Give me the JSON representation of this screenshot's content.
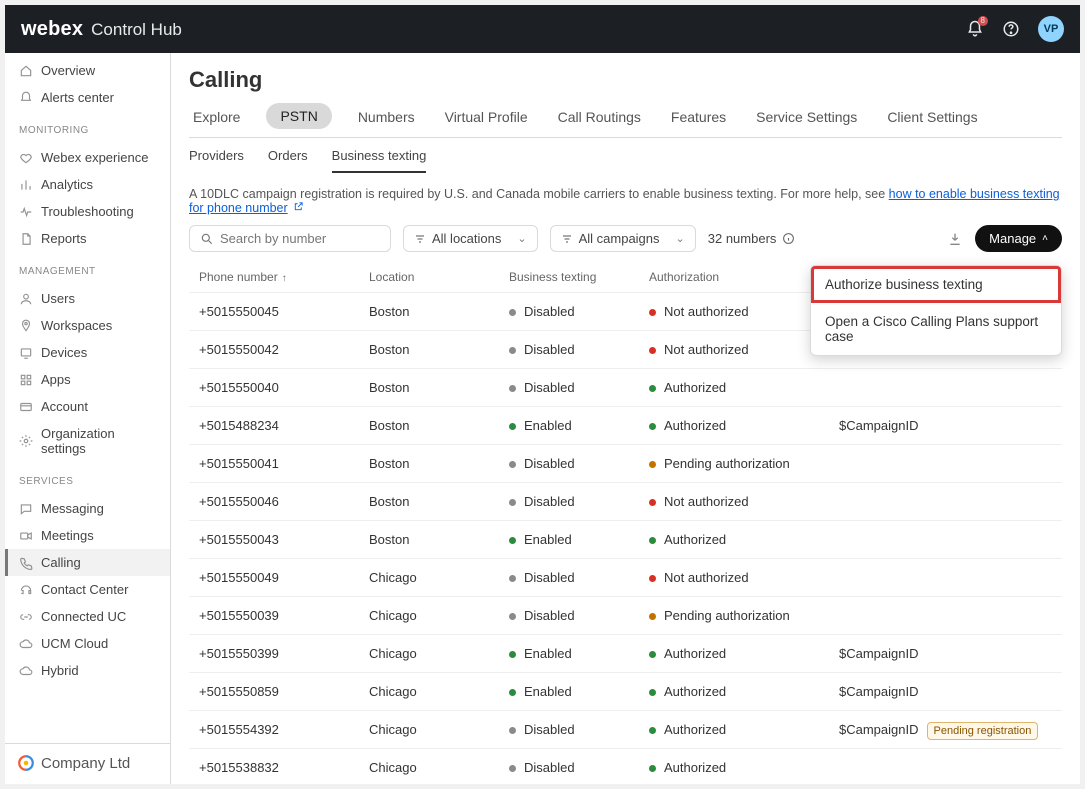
{
  "header": {
    "brand_bold": "webex",
    "brand_light": "Control Hub",
    "notif_count": "8",
    "avatar_initials": "VP"
  },
  "sidebar": {
    "top": [
      {
        "icon": "home",
        "label": "Overview"
      },
      {
        "icon": "bell",
        "label": "Alerts center"
      }
    ],
    "monitoring_label": "MONITORING",
    "monitoring": [
      {
        "icon": "heart",
        "label": "Webex experience"
      },
      {
        "icon": "bars",
        "label": "Analytics"
      },
      {
        "icon": "pulse",
        "label": "Troubleshooting"
      },
      {
        "icon": "doc",
        "label": "Reports"
      }
    ],
    "management_label": "MANAGEMENT",
    "management": [
      {
        "icon": "user",
        "label": "Users"
      },
      {
        "icon": "pin",
        "label": "Workspaces"
      },
      {
        "icon": "device",
        "label": "Devices"
      },
      {
        "icon": "grid",
        "label": "Apps"
      },
      {
        "icon": "card",
        "label": "Account"
      },
      {
        "icon": "gear",
        "label": "Organization settings"
      }
    ],
    "services_label": "SERVICES",
    "services": [
      {
        "icon": "chat",
        "label": "Messaging"
      },
      {
        "icon": "video",
        "label": "Meetings"
      },
      {
        "icon": "phone",
        "label": "Calling",
        "active": true
      },
      {
        "icon": "headset",
        "label": "Contact Center"
      },
      {
        "icon": "link",
        "label": "Connected UC"
      },
      {
        "icon": "cloud",
        "label": "UCM Cloud"
      },
      {
        "icon": "cloud2",
        "label": "Hybrid"
      }
    ],
    "footer_company": "Company Ltd"
  },
  "page": {
    "title": "Calling",
    "tabs": [
      "Explore",
      "PSTN",
      "Numbers",
      "Virtual Profile",
      "Call Routings",
      "Features",
      "Service Settings",
      "Client Settings"
    ],
    "active_tab": 1,
    "subtabs": [
      "Providers",
      "Orders",
      "Business texting"
    ],
    "active_subtab": 2,
    "info_text": "A 10DLC campaign registration is required by U.S. and Canada mobile carriers to enable business texting. For more help, see ",
    "info_link": "how to enable business texting for phone number",
    "search_placeholder": "Search by number",
    "filter_locations": "All locations",
    "filter_campaigns": "All campaigns",
    "count_label": "32 numbers",
    "manage_label": "Manage",
    "dropdown": [
      "Authorize business texting",
      "Open a Cisco Calling Plans support case"
    ],
    "columns": [
      "Phone number",
      "Location",
      "Business texting",
      "Authorization",
      ""
    ],
    "rows": [
      {
        "num": "+5015550045",
        "loc": "Boston",
        "bt": "Disabled",
        "btc": "gray",
        "auth": "Not authorized",
        "authc": "red",
        "camp": ""
      },
      {
        "num": "+5015550042",
        "loc": "Boston",
        "bt": "Disabled",
        "btc": "gray",
        "auth": "Not authorized",
        "authc": "red",
        "camp": ""
      },
      {
        "num": "+5015550040",
        "loc": "Boston",
        "bt": "Disabled",
        "btc": "gray",
        "auth": "Authorized",
        "authc": "green",
        "camp": ""
      },
      {
        "num": "+5015488234",
        "loc": "Boston",
        "bt": "Enabled",
        "btc": "green",
        "auth": "Authorized",
        "authc": "green",
        "camp": "$CampaignID"
      },
      {
        "num": "+5015550041",
        "loc": "Boston",
        "bt": "Disabled",
        "btc": "gray",
        "auth": "Pending authorization",
        "authc": "amber",
        "camp": ""
      },
      {
        "num": "+5015550046",
        "loc": "Boston",
        "bt": "Disabled",
        "btc": "gray",
        "auth": "Not authorized",
        "authc": "red",
        "camp": ""
      },
      {
        "num": "+5015550043",
        "loc": "Boston",
        "bt": "Enabled",
        "btc": "green",
        "auth": "Authorized",
        "authc": "green",
        "camp": ""
      },
      {
        "num": "+5015550049",
        "loc": "Chicago",
        "bt": "Disabled",
        "btc": "gray",
        "auth": "Not authorized",
        "authc": "red",
        "camp": ""
      },
      {
        "num": "+5015550039",
        "loc": "Chicago",
        "bt": "Disabled",
        "btc": "gray",
        "auth": "Pending authorization",
        "authc": "amber",
        "camp": ""
      },
      {
        "num": "+5015550399",
        "loc": "Chicago",
        "bt": "Enabled",
        "btc": "green",
        "auth": "Authorized",
        "authc": "green",
        "camp": "$CampaignID"
      },
      {
        "num": "+5015550859",
        "loc": "Chicago",
        "bt": "Enabled",
        "btc": "green",
        "auth": "Authorized",
        "authc": "green",
        "camp": "$CampaignID"
      },
      {
        "num": "+5015554392",
        "loc": "Chicago",
        "bt": "Disabled",
        "btc": "gray",
        "auth": "Authorized",
        "authc": "green",
        "camp": "$CampaignID",
        "badge": "Pending registration"
      },
      {
        "num": "+5015538832",
        "loc": "Chicago",
        "bt": "Disabled",
        "btc": "gray",
        "auth": "Authorized",
        "authc": "green",
        "camp": ""
      }
    ]
  }
}
